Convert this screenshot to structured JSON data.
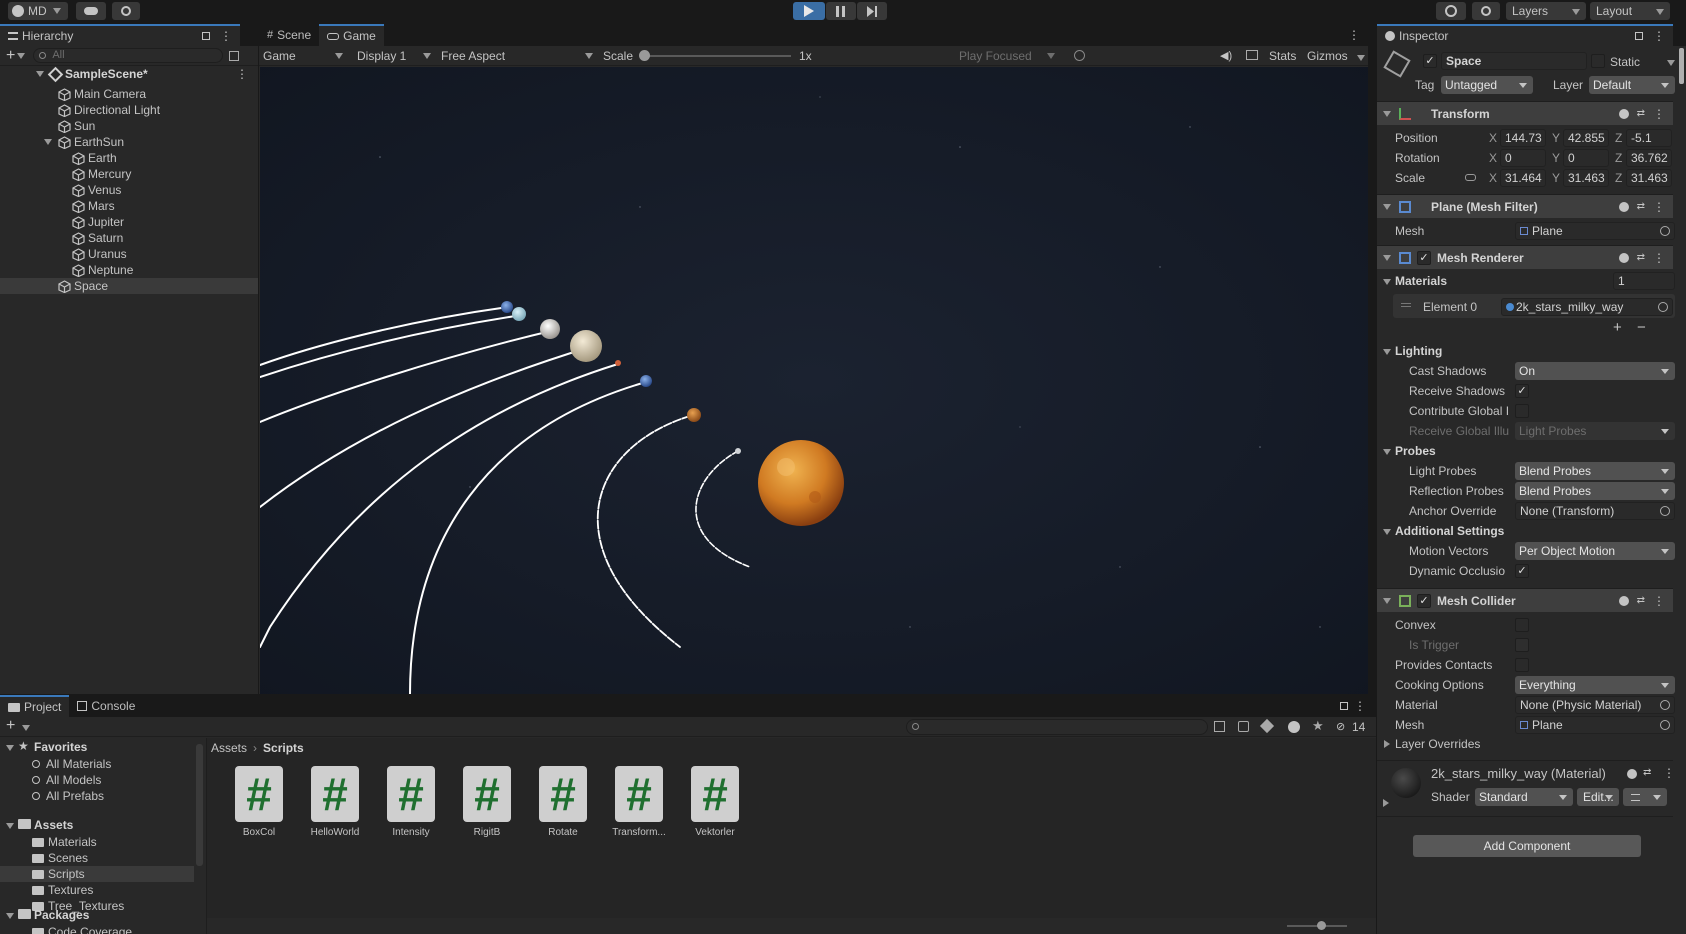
{
  "toolbar": {
    "account": "MD",
    "layers": "Layers",
    "layout": "Layout"
  },
  "hierarchy": {
    "tab": "Hierarchy",
    "search_placeholder": "All",
    "scene": "SampleScene*",
    "items": [
      {
        "label": "Main Camera",
        "depth": 1
      },
      {
        "label": "Directional Light",
        "depth": 1
      },
      {
        "label": "Sun",
        "depth": 1
      },
      {
        "label": "EarthSun",
        "depth": 1,
        "expanded": true
      },
      {
        "label": "Earth",
        "depth": 2
      },
      {
        "label": "Mercury",
        "depth": 2
      },
      {
        "label": "Venus",
        "depth": 2
      },
      {
        "label": "Mars",
        "depth": 2
      },
      {
        "label": "Jupiter",
        "depth": 2
      },
      {
        "label": "Saturn",
        "depth": 2
      },
      {
        "label": "Uranus",
        "depth": 2
      },
      {
        "label": "Neptune",
        "depth": 2
      },
      {
        "label": "Space",
        "depth": 1,
        "selected": true
      }
    ]
  },
  "game": {
    "tabs": [
      "Scene",
      "Game"
    ],
    "mode": "Game",
    "display": "Display 1",
    "aspect": "Free Aspect",
    "scale_label": "Scale",
    "scale_value": "1x",
    "play_focused": "Play Focused",
    "stats": "Stats",
    "gizmos": "Gizmos"
  },
  "inspector": {
    "tab": "Inspector",
    "object_name": "Space",
    "static_label": "Static",
    "tag_label": "Tag",
    "tag": "Untagged",
    "layer_label": "Layer",
    "layer": "Default",
    "transform": {
      "title": "Transform",
      "position_label": "Position",
      "rotation_label": "Rotation",
      "scale_label": "Scale",
      "position": [
        "144.73",
        "42.855",
        "-5.1"
      ],
      "rotation": [
        "0",
        "0",
        "36.762"
      ],
      "scale": [
        "31.464",
        "31.463",
        "31.463"
      ]
    },
    "mesh_filter": {
      "title": "Plane (Mesh Filter)",
      "mesh_label": "Mesh",
      "mesh": "Plane"
    },
    "mesh_renderer": {
      "title": "Mesh Renderer",
      "materials_label": "Materials",
      "materials_count": "1",
      "element_label": "Element 0",
      "element_value": "2k_stars_milky_way",
      "lighting": "Lighting",
      "cast_shadows_label": "Cast Shadows",
      "cast_shadows": "On",
      "receive_shadows_label": "Receive Shadows",
      "contribute_gi_label": "Contribute Global I",
      "receive_gi_label": "Receive Global Illu",
      "receive_gi": "Light Probes",
      "probes": "Probes",
      "light_probes_label": "Light Probes",
      "light_probes": "Blend Probes",
      "reflection_probes_label": "Reflection Probes",
      "reflection_probes": "Blend Probes",
      "anchor_label": "Anchor Override",
      "anchor": "None (Transform)",
      "additional": "Additional Settings",
      "motion_label": "Motion Vectors",
      "motion": "Per Object Motion",
      "dynamic_label": "Dynamic Occlusio"
    },
    "mesh_collider": {
      "title": "Mesh Collider",
      "convex_label": "Convex",
      "trigger_label": "Is Trigger",
      "contacts_label": "Provides Contacts",
      "cooking_label": "Cooking Options",
      "cooking": "Everything",
      "material_label": "Material",
      "material": "None (Physic Material)",
      "mesh_label": "Mesh",
      "mesh": "Plane",
      "layer_overrides": "Layer Overrides"
    },
    "material": {
      "title": "2k_stars_milky_way (Material)",
      "shader_label": "Shader",
      "shader": "Standard",
      "edit": "Edit..."
    },
    "add_component": "Add Component"
  },
  "project": {
    "tabs": [
      "Project",
      "Console"
    ],
    "hidden_count": "14",
    "favorites_label": "Favorites",
    "favorites": [
      "All Materials",
      "All Models",
      "All Prefabs"
    ],
    "assets_label": "Assets",
    "asset_folders": [
      "Materials",
      "Scenes",
      "Scripts",
      "Textures",
      "Tree_Textures"
    ],
    "packages_label": "Packages",
    "package_folders": [
      "Code Coverage"
    ],
    "breadcrumb": [
      "Assets",
      "Scripts"
    ],
    "scripts": [
      "BoxCol",
      "HelloWorld",
      "Intensity",
      "RigitB",
      "Rotate",
      "Transform...",
      "Vektorler"
    ]
  }
}
